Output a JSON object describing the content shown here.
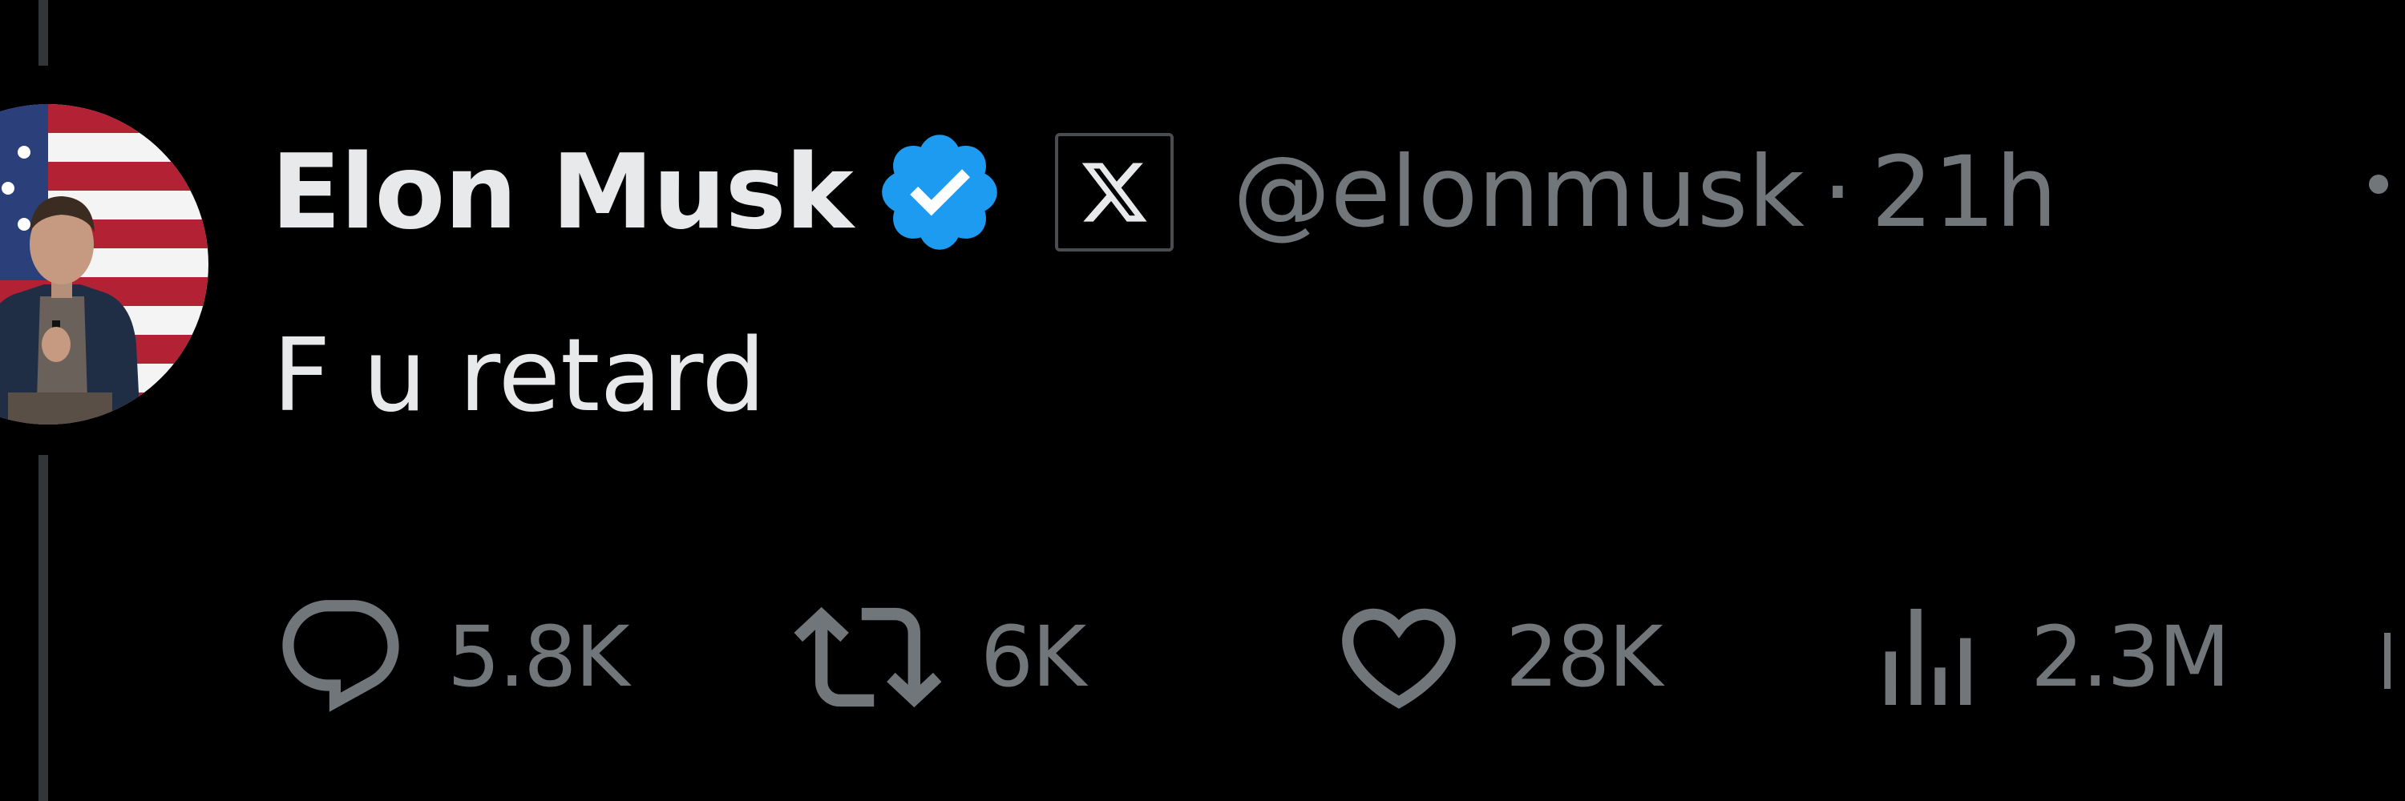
{
  "tweet": {
    "author": {
      "display_name": "Elon Musk",
      "handle": "@elonmusk",
      "verified_icon": "verified-badge-icon",
      "affiliate_icon": "x-logo-icon",
      "avatar": "profile-photo-with-flag"
    },
    "separator": "·",
    "timestamp": "21h",
    "text": "F u retard",
    "actions": {
      "reply": {
        "icon": "reply-icon",
        "count": "5.8K"
      },
      "retweet": {
        "icon": "retweet-icon",
        "count": "6K"
      },
      "like": {
        "icon": "heart-icon",
        "count": "28K"
      },
      "views": {
        "icon": "analytics-icon",
        "count": "2.3M"
      }
    }
  },
  "colors": {
    "background": "#000000",
    "primary_text": "#e7e9ea",
    "secondary_text": "#71767b",
    "verified_blue": "#1d9bf0",
    "thread_line": "#333639"
  }
}
